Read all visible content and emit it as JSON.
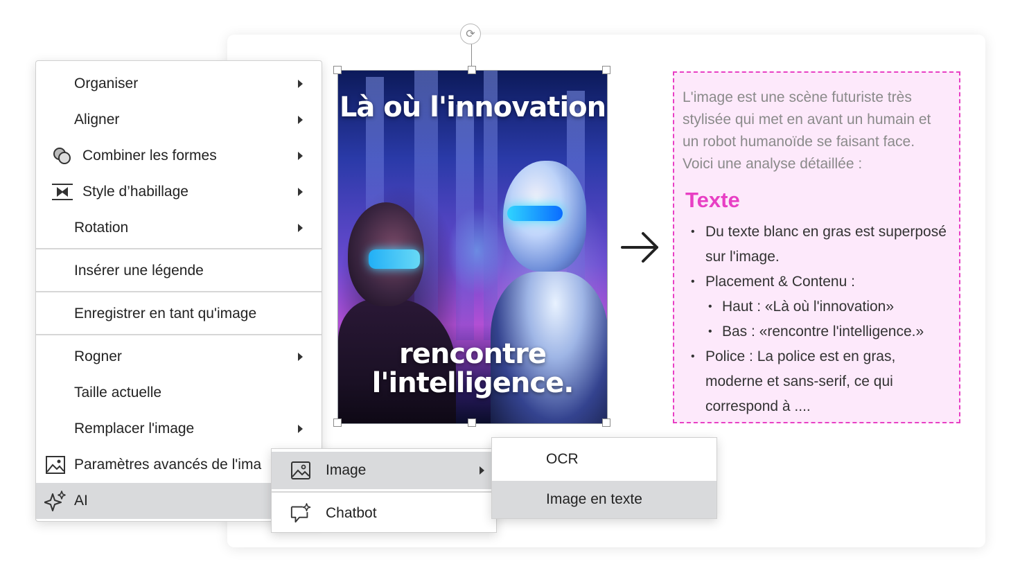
{
  "image": {
    "text_top": "Là où l'innovation",
    "text_bottom": "rencontre l'intelligence."
  },
  "result": {
    "intro": "L'image est une scène futuriste très stylisée qui met en avant un humain et un robot humanoïde se faisant face. Voici une analyse détaillée :",
    "heading": "Texte",
    "bullet1": "Du texte blanc en gras est superposé sur l'image.",
    "bullet2": "Placement & Contenu :",
    "bullet2_sub1": "Haut : «Là où l'innovation»",
    "bullet2_sub2": "Bas : «rencontre l'intelligence.»",
    "bullet3": "Police : La police est en gras, moderne et sans-serif, ce qui correspond à ...."
  },
  "menu": {
    "items": [
      {
        "label": "Organiser",
        "icon": "",
        "has_submenu": true
      },
      {
        "label": "Aligner",
        "icon": "",
        "has_submenu": true
      },
      {
        "label": "Combiner les formes",
        "icon": "combine-shapes-icon",
        "has_submenu": true
      },
      {
        "label": "Style d’habillage",
        "icon": "wrap-style-icon",
        "has_submenu": true
      },
      {
        "label": "Rotation",
        "icon": "",
        "has_submenu": true
      },
      {
        "label": "Insérer une légende",
        "icon": "",
        "has_submenu": false
      },
      {
        "label": "Enregistrer en tant qu'image",
        "icon": "",
        "has_submenu": false
      },
      {
        "label": "Rogner",
        "icon": "",
        "has_submenu": true
      },
      {
        "label": "Taille actuelle",
        "icon": "",
        "has_submenu": false
      },
      {
        "label": "Remplacer l'image",
        "icon": "",
        "has_submenu": true
      },
      {
        "label": "Paramètres avancés de l'ima",
        "icon": "image-settings-icon",
        "has_submenu": false
      },
      {
        "label": "AI",
        "icon": "ai-sparkle-icon",
        "has_submenu": true
      }
    ]
  },
  "ai_submenu": {
    "items": [
      {
        "label": "Image",
        "icon": "image-icon",
        "has_submenu": true
      },
      {
        "label": "Chatbot",
        "icon": "chatbot-icon",
        "has_submenu": false
      }
    ]
  },
  "image_submenu": {
    "items": [
      {
        "label": "OCR"
      },
      {
        "label": "Image en texte"
      }
    ]
  },
  "colors": {
    "accent_pink": "#e83fc4",
    "panel_background": "#fde9fb",
    "menu_highlight": "#d9dadc"
  }
}
